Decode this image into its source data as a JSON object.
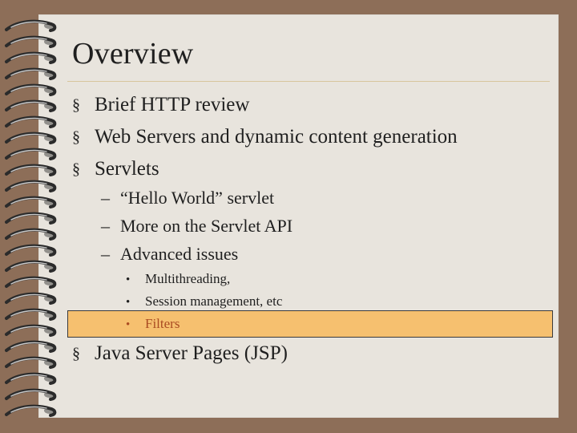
{
  "slide": {
    "title": "Overview",
    "bullets": [
      {
        "marker": "§",
        "text": "Brief HTTP review"
      },
      {
        "marker": "§",
        "text": "Web Servers and dynamic content generation"
      },
      {
        "marker": "§",
        "text": "Servlets"
      },
      {
        "marker": "§",
        "text": "Java Server Pages (JSP)"
      }
    ],
    "sub_bullets": [
      {
        "marker": "–",
        "text": "“Hello World” servlet"
      },
      {
        "marker": "–",
        "text": "More on the Servlet API"
      },
      {
        "marker": "–",
        "text": "Advanced issues"
      }
    ],
    "sub_sub_bullets": [
      {
        "marker": "•",
        "text": "Multithreading,"
      },
      {
        "marker": "•",
        "text": "Session management, etc"
      },
      {
        "marker": "•",
        "text": "Filters"
      }
    ]
  },
  "colors": {
    "frame": "#8d6e58",
    "paper": "#e8e4dd",
    "highlight": "#f6c06f",
    "highlight_text": "#aa4b22",
    "text": "#1f1f1f"
  }
}
